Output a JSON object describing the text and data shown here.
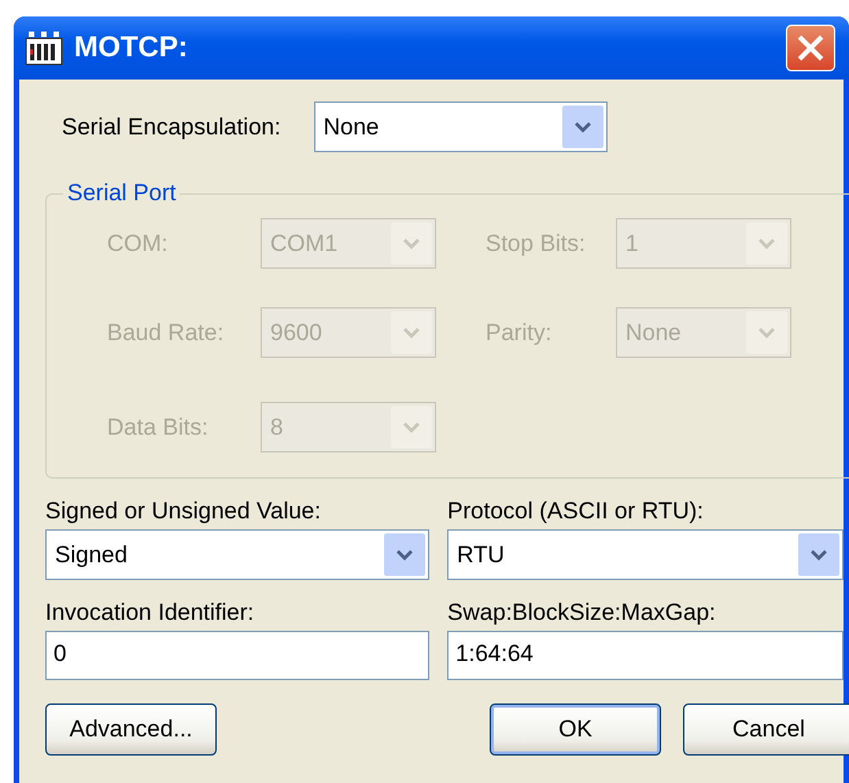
{
  "window": {
    "title": "MOTCP:"
  },
  "serial_encapsulation": {
    "label": "Serial Encapsulation:",
    "value": "None"
  },
  "serial_port": {
    "title": "Serial Port",
    "disabled": true,
    "fields": [
      {
        "label": "COM:",
        "value": "COM1"
      },
      {
        "label": "Stop Bits:",
        "value": "1"
      },
      {
        "label": "Baud Rate:",
        "value": "9600"
      },
      {
        "label": "Parity:",
        "value": "None"
      },
      {
        "label": "Data Bits:",
        "value": "8"
      }
    ]
  },
  "signed": {
    "label": "Signed or Unsigned Value:",
    "value": "Signed"
  },
  "protocol": {
    "label": "Protocol (ASCII or RTU):",
    "value": "RTU"
  },
  "invocation": {
    "label": "Invocation Identifier:",
    "value": "0"
  },
  "swap": {
    "label": "Swap:BlockSize:MaxGap:",
    "value": "1:64:64"
  },
  "buttons": [
    {
      "label": "Advanced...",
      "kind": "left",
      "default": false
    },
    {
      "label": "OK",
      "kind": "right",
      "default": true
    },
    {
      "label": "Cancel",
      "kind": "right",
      "default": false
    }
  ]
}
